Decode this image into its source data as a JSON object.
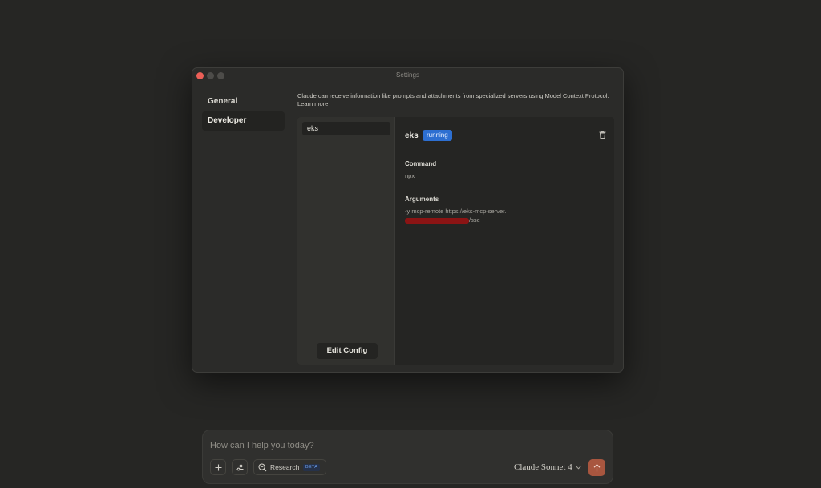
{
  "window": {
    "title": "Settings"
  },
  "nav": {
    "general": "General",
    "developer": "Developer"
  },
  "developer": {
    "intro": "Claude can receive information like prompts and attachments from specialized servers using Model Context Protocol.",
    "learn_more": "Learn more",
    "servers": [
      {
        "name": "eks"
      }
    ],
    "edit_config_label": "Edit Config",
    "selected": {
      "name": "eks",
      "status": "running",
      "command_label": "Command",
      "command": "npx",
      "arguments_label": "Arguments",
      "arguments_prefix": "-y mcp-remote https://eks-mcp-server.",
      "arguments_suffix": "/sse"
    }
  },
  "composer": {
    "placeholder": "How can I help you today?",
    "research_label": "Research",
    "beta_badge": "BETA",
    "model_name": "Claude Sonnet 4"
  },
  "colors": {
    "background": "#262624",
    "window": "#2b2b29",
    "status_badge": "#2d6fd1",
    "send_button": "#a8563f",
    "close_light": "#ec5f57"
  }
}
